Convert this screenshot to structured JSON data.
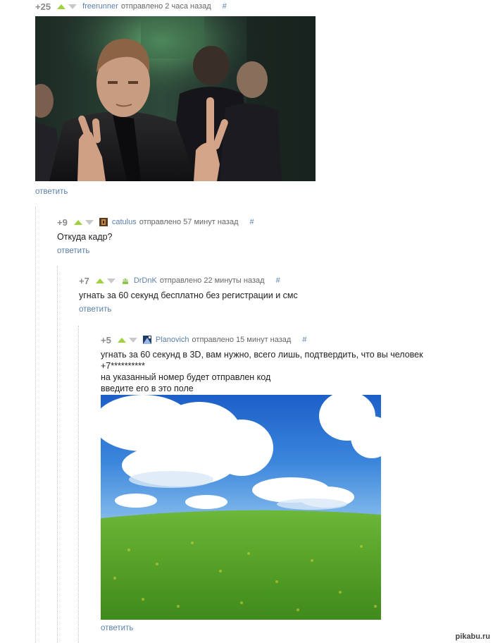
{
  "reply_label": "ответить",
  "comments": [
    {
      "rating": "+25",
      "user": "freerunner",
      "meta": "отправлено 2 часа назад",
      "hash": "#",
      "image": "movie-still-nicolas-cage-gesturing"
    },
    {
      "rating": "+9",
      "user": "catulus",
      "meta": "отправлено 57 минут назад",
      "hash": "#",
      "text": "Откуда кадр?"
    },
    {
      "rating": "+7",
      "user": "DrDnK",
      "meta": "отправлено 22 минуты назад",
      "hash": "#",
      "text": "угнать за 60 секунд бесплатно без регистрации и смс"
    },
    {
      "rating": "+5",
      "user": "Planovich",
      "meta": "отправлено 15 минут назад",
      "hash": "#",
      "lines": [
        "угнать за 60 секунд в 3D, вам нужно, всего лишь, подтвердить, что вы человек",
        "+7**********",
        "на указанный номер будет отправлен код",
        "введите его в это поле"
      ],
      "image": "bliss-wallpaper-green-hill-blue-sky"
    }
  ],
  "watermark": "pikabu.ru",
  "colors": {
    "upvote": "#9ed13c",
    "downvote": "#c9c9c9",
    "link": "#5a7fa8"
  }
}
